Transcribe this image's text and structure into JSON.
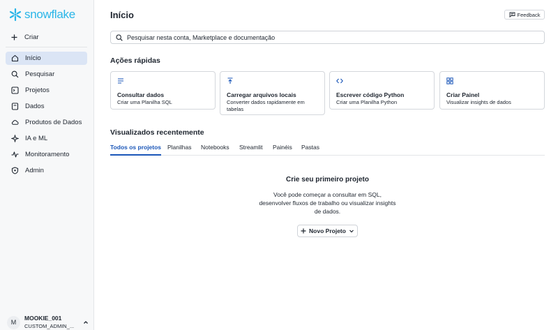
{
  "brand": {
    "logo_text": "snowflake",
    "color": "#29b5e8"
  },
  "sidebar": {
    "create_label": "Criar",
    "items": [
      {
        "label": "Início",
        "icon": "home-icon",
        "active": true
      },
      {
        "label": "Pesquisar",
        "icon": "search-icon",
        "active": false
      },
      {
        "label": "Projetos",
        "icon": "projects-icon",
        "active": false
      },
      {
        "label": "Dados",
        "icon": "database-icon",
        "active": false
      },
      {
        "label": "Produtos de Dados",
        "icon": "cloud-icon",
        "active": false
      },
      {
        "label": "IA e ML",
        "icon": "ai-ml-icon",
        "active": false
      },
      {
        "label": "Monitoramento",
        "icon": "activity-icon",
        "active": false
      },
      {
        "label": "Admin",
        "icon": "shield-icon",
        "active": false
      }
    ],
    "user": {
      "initial": "M",
      "name": "MOOKIE_001",
      "role": "CUSTOM_ADMIN_..."
    }
  },
  "header": {
    "title": "Início",
    "feedback_label": "Feedback"
  },
  "search": {
    "placeholder": "Pesquisar nesta conta, Marketplace e documentação"
  },
  "quick_actions": {
    "title": "Ações rápidas",
    "cards": [
      {
        "title": "Consultar dados",
        "desc": "Criar uma Planilha SQL",
        "icon": "lines-icon"
      },
      {
        "title": "Carregar arquivos locais",
        "desc": "Converter dados rapidamente em tabelas",
        "icon": "upload-icon"
      },
      {
        "title": "Escrever código Python",
        "desc": "Criar uma Planilha Python",
        "icon": "code-icon"
      },
      {
        "title": "Criar Painel",
        "desc": "Visualizar insights de dados",
        "icon": "dashboard-icon"
      }
    ]
  },
  "recent": {
    "title": "Visualizados recentemente",
    "tabs": [
      "Todos os projetos",
      "Planilhas",
      "Notebooks",
      "Streamlit",
      "Painéis",
      "Pastas"
    ],
    "active_tab": "Todos os projetos"
  },
  "empty": {
    "title": "Crie seu primeiro projeto",
    "desc": "Você pode começar a consultar em SQL, desenvolver fluxos de trabalho ou visualizar insights de dados.",
    "button_label": "Novo Projeto"
  },
  "colors": {
    "active_nav_bg": "#dbe5f5",
    "accent_blue": "#1a56b8"
  }
}
